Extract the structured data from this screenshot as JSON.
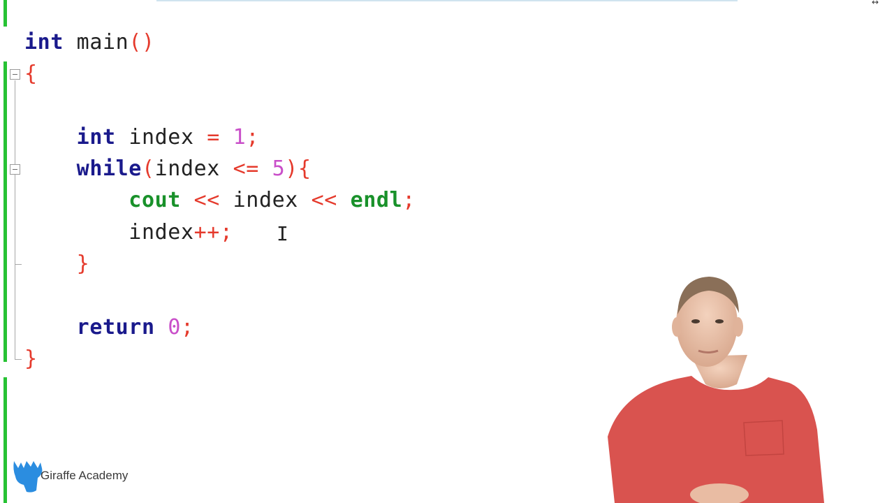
{
  "editor": {
    "lines": [
      [
        {
          "t": "int",
          "c": "kw"
        },
        {
          "t": " ",
          "c": "ident"
        },
        {
          "t": "main",
          "c": "ident"
        },
        {
          "t": "()",
          "c": "op"
        }
      ],
      [
        {
          "t": "{",
          "c": "op"
        }
      ],
      [],
      [
        {
          "t": "    ",
          "c": "ident"
        },
        {
          "t": "int",
          "c": "kw"
        },
        {
          "t": " index ",
          "c": "ident"
        },
        {
          "t": "=",
          "c": "op"
        },
        {
          "t": " ",
          "c": "ident"
        },
        {
          "t": "1",
          "c": "num"
        },
        {
          "t": ";",
          "c": "op"
        }
      ],
      [
        {
          "t": "    ",
          "c": "ident"
        },
        {
          "t": "while",
          "c": "kw"
        },
        {
          "t": "(",
          "c": "op"
        },
        {
          "t": "index ",
          "c": "ident"
        },
        {
          "t": "<=",
          "c": "op"
        },
        {
          "t": " ",
          "c": "ident"
        },
        {
          "t": "5",
          "c": "num"
        },
        {
          "t": "){",
          "c": "op"
        }
      ],
      [
        {
          "t": "        ",
          "c": "ident"
        },
        {
          "t": "cout",
          "c": "fn"
        },
        {
          "t": " ",
          "c": "ident"
        },
        {
          "t": "<<",
          "c": "op"
        },
        {
          "t": " index ",
          "c": "ident"
        },
        {
          "t": "<<",
          "c": "op"
        },
        {
          "t": " ",
          "c": "ident"
        },
        {
          "t": "endl",
          "c": "fn"
        },
        {
          "t": ";",
          "c": "op"
        }
      ],
      [
        {
          "t": "        ",
          "c": "ident"
        },
        {
          "t": "index",
          "c": "ident"
        },
        {
          "t": "++;",
          "c": "op"
        }
      ],
      [
        {
          "t": "    ",
          "c": "ident"
        },
        {
          "t": "}",
          "c": "op"
        }
      ],
      [],
      [
        {
          "t": "    ",
          "c": "ident"
        },
        {
          "t": "return",
          "c": "kw"
        },
        {
          "t": " ",
          "c": "ident"
        },
        {
          "t": "0",
          "c": "num"
        },
        {
          "t": ";",
          "c": "op"
        }
      ],
      [
        {
          "t": "}",
          "c": "op"
        }
      ]
    ],
    "text_cursor_glyph": "I",
    "resize_glyph": "↔"
  },
  "branding": {
    "name": "Giraffe Academy",
    "logo_icon": "giraffe-icon",
    "logo_color": "#2b8de0"
  },
  "colors": {
    "keyword": "#1a1a8c",
    "function": "#19912a",
    "operator": "#e53a2c",
    "number": "#c94fc9",
    "change_bar": "#27c234"
  },
  "presenter": {
    "shirt_color": "#d9534f"
  }
}
